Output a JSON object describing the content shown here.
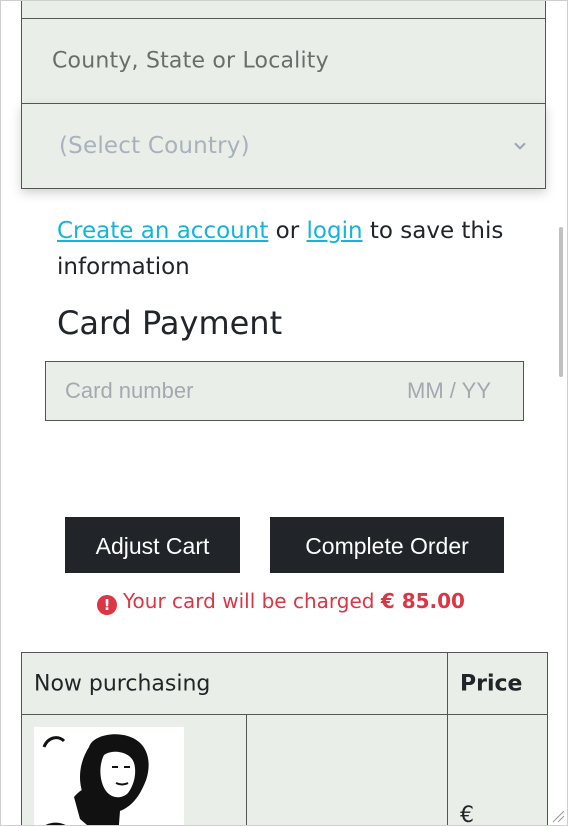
{
  "address": {
    "county_placeholder": "County, State or Locality",
    "country_selected": "(Select Country)"
  },
  "account": {
    "create_link": "Create an account",
    "or_text": "or",
    "login_link": "login",
    "suffix_text": "to save this information"
  },
  "payment": {
    "section_title": "Card Payment",
    "card_number_placeholder": "Card number",
    "expiry_placeholder": "MM / YY"
  },
  "actions": {
    "adjust_label": "Adjust Cart",
    "complete_label": "Complete Order"
  },
  "charge": {
    "prefix": "Your card will be charged",
    "amount": "€ 85.00"
  },
  "summary": {
    "header_item": "Now purchasing",
    "header_price": "Price",
    "row_price_partial": "€"
  },
  "colors": {
    "field_bg": "#e9efe8",
    "button_bg": "#212529",
    "link": "#14b3e0",
    "alert": "#dc3545"
  },
  "icons": [
    "chevron-down-icon",
    "alert-icon",
    "resize-grip-icon"
  ]
}
